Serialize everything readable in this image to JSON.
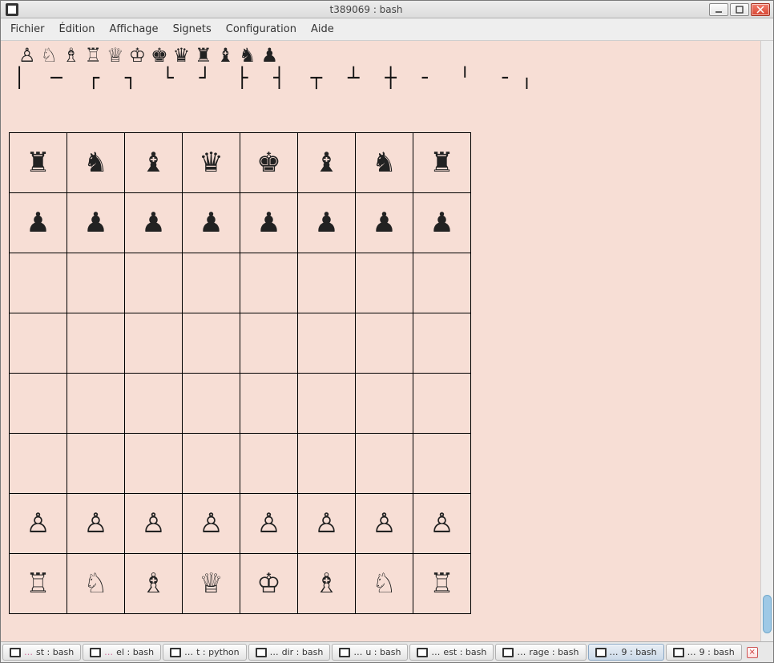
{
  "window": {
    "title": "t389069 : bash"
  },
  "menus": [
    "Fichier",
    "Édition",
    "Affichage",
    "Signets",
    "Configuration",
    "Aide"
  ],
  "piece_glyphs": [
    "♙",
    "♘",
    "♗",
    "♖",
    "♕",
    "♔",
    "♚",
    "♛",
    "♜",
    "♝",
    "♞",
    "♟"
  ],
  "box_row": "│  ─  ┌  ┐  └  ┘  ├  ┤  ┬  ┴  ┼  ╴  ╵  ╶ ╷  ",
  "board": [
    [
      "♜",
      "♞",
      "♝",
      "♛",
      "♚",
      "♝",
      "♞",
      "♜"
    ],
    [
      "♟",
      "♟",
      "♟",
      "♟",
      "♟",
      "♟",
      "♟",
      "♟"
    ],
    [
      "",
      "",
      "",
      "",
      "",
      "",
      "",
      ""
    ],
    [
      "",
      "",
      "",
      "",
      "",
      "",
      "",
      ""
    ],
    [
      "",
      "",
      "",
      "",
      "",
      "",
      "",
      ""
    ],
    [
      "",
      "",
      "",
      "",
      "",
      "",
      "",
      ""
    ],
    [
      "♙",
      "♙",
      "♙",
      "♙",
      "♙",
      "♙",
      "♙",
      "♙"
    ],
    [
      "♖",
      "♘",
      "♗",
      "♕",
      "♔",
      "♗",
      "♘",
      "♖"
    ]
  ],
  "tasks": [
    {
      "prefix": "…",
      "label": "st : bash",
      "pink": true,
      "active": false
    },
    {
      "prefix": "…",
      "label": "el : bash",
      "pink": true,
      "active": false
    },
    {
      "prefix": "…",
      "label": "t : python",
      "pink": false,
      "active": false
    },
    {
      "prefix": "…",
      "label": "dir : bash",
      "pink": false,
      "active": false
    },
    {
      "prefix": "…",
      "label": "u : bash",
      "pink": false,
      "active": false
    },
    {
      "prefix": "…",
      "label": "est : bash",
      "pink": false,
      "active": false
    },
    {
      "prefix": "…",
      "label": "rage : bash",
      "pink": false,
      "active": false
    },
    {
      "prefix": "…",
      "label": "9 : bash",
      "pink": false,
      "active": true
    },
    {
      "prefix": "…",
      "label": "9 : bash",
      "pink": false,
      "active": false
    }
  ]
}
